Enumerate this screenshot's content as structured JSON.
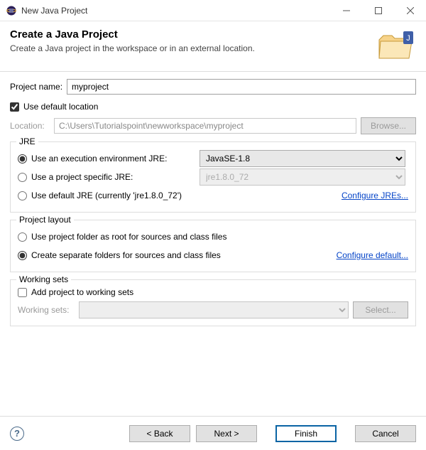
{
  "titlebar": {
    "title": "New Java Project"
  },
  "banner": {
    "heading": "Create a Java Project",
    "sub": "Create a Java project in the workspace or in an external location."
  },
  "project": {
    "name_label": "Project name:",
    "name_value": "myproject",
    "use_default_label": "Use default location",
    "use_default_checked": true,
    "location_label": "Location:",
    "location_value": "C:\\Users\\Tutorialspoint\\newworkspace\\myproject",
    "browse_label": "Browse..."
  },
  "jre": {
    "legend": "JRE",
    "opt_exec_env": "Use an execution environment JRE:",
    "exec_env_value": "JavaSE-1.8",
    "opt_project_specific": "Use a project specific JRE:",
    "project_jre_value": "jre1.8.0_72",
    "opt_default": "Use default JRE (currently 'jre1.8.0_72')",
    "configure_link": "Configure JREs...",
    "selected": "exec_env"
  },
  "layout": {
    "legend": "Project layout",
    "opt_root": "Use project folder as root for sources and class files",
    "opt_separate": "Create separate folders for sources and class files",
    "configure_link": "Configure default...",
    "selected": "separate"
  },
  "working_sets": {
    "legend": "Working sets",
    "add_label": "Add project to working sets",
    "add_checked": false,
    "ws_label": "Working sets:",
    "select_label": "Select..."
  },
  "buttons": {
    "back": "< Back",
    "next": "Next >",
    "finish": "Finish",
    "cancel": "Cancel",
    "help": "?"
  }
}
